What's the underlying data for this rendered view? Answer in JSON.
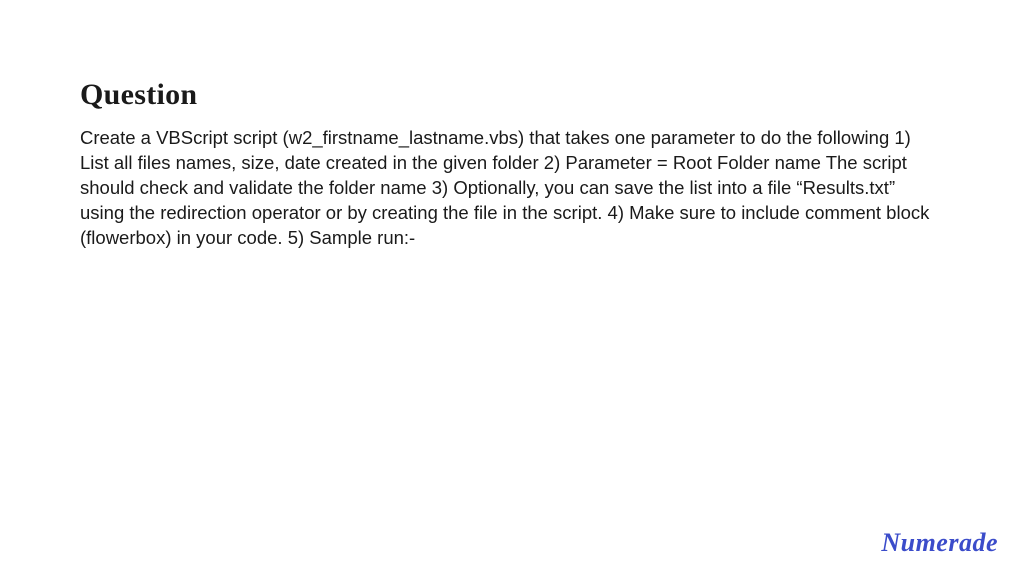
{
  "heading": "Question",
  "body": "Create a VBScript script (w2_firstname_lastname.vbs) that takes one parameter to do the following 1) List all files names, size, date created in the given folder 2) Parameter = Root Folder name The script should check and validate the folder name 3) Optionally, you can save the list into a file “Results.txt” using the redirection operator or by creating the file in the script. 4) Make sure to include comment block (flowerbox) in your code. 5) Sample run:-",
  "brand": "Numerade"
}
